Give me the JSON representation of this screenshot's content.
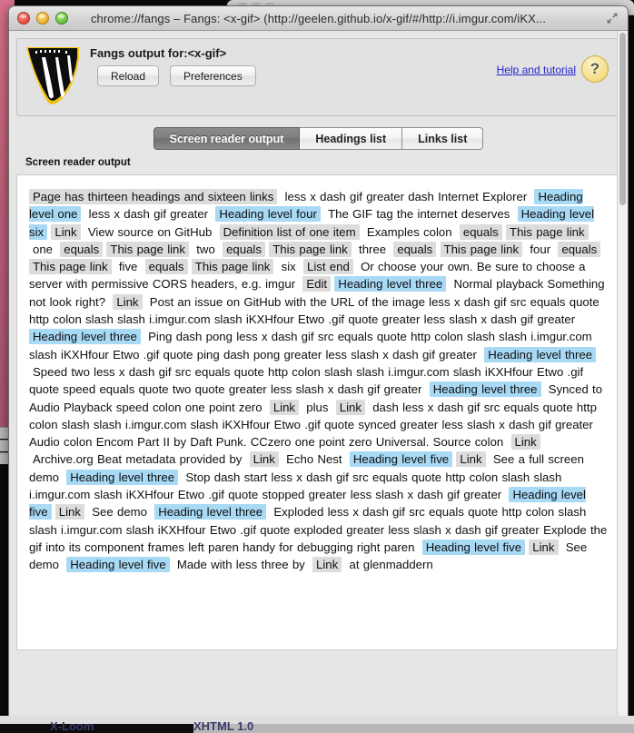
{
  "window": {
    "title": "chrome://fangs – Fangs: <x-gif> (http://geelen.github.io/x-gif/#/http://i.imgur.com/iKX...",
    "traffic_lights": [
      "close-button",
      "minimize-button",
      "zoom-button"
    ],
    "fullscreen_icon": "expand-arrows-icon"
  },
  "header": {
    "logo_icon": "fangs-logo-icon",
    "title": "Fangs output for:<x-gif>",
    "reload_label": "Reload",
    "preferences_label": "Preferences",
    "help_link_label": "Help and tutorial",
    "help_badge_glyph": "?"
  },
  "tabs": [
    {
      "label": "Screen reader output",
      "active": true
    },
    {
      "label": "Headings list",
      "active": false
    },
    {
      "label": "Links list",
      "active": false
    }
  ],
  "main": {
    "section_label": "Screen reader output",
    "segments": [
      {
        "kind": "struct",
        "text": "Page has thirteen headings and sixteen links"
      },
      {
        "kind": "plain",
        "text": "less x dash gif greater dash Internet Explorer"
      },
      {
        "kind": "head",
        "text": "Heading level one"
      },
      {
        "kind": "plain",
        "text": "less x dash gif greater"
      },
      {
        "kind": "head",
        "text": "Heading level four"
      },
      {
        "kind": "plain",
        "text": "The GIF tag the internet deserves"
      },
      {
        "kind": "head",
        "text": "Heading level six"
      },
      {
        "kind": "struct",
        "text": "Link"
      },
      {
        "kind": "plain",
        "text": "View source on GitHub"
      },
      {
        "kind": "struct",
        "text": "Definition list of one item"
      },
      {
        "kind": "plain",
        "text": "Examples colon"
      },
      {
        "kind": "struct",
        "text": "equals"
      },
      {
        "kind": "struct",
        "text": "This page link"
      },
      {
        "kind": "plain",
        "text": "one"
      },
      {
        "kind": "struct",
        "text": "equals"
      },
      {
        "kind": "struct",
        "text": "This page link"
      },
      {
        "kind": "plain",
        "text": "two"
      },
      {
        "kind": "struct",
        "text": "equals"
      },
      {
        "kind": "struct",
        "text": "This page link"
      },
      {
        "kind": "plain",
        "text": "three"
      },
      {
        "kind": "struct",
        "text": "equals"
      },
      {
        "kind": "struct",
        "text": "This page link"
      },
      {
        "kind": "plain",
        "text": "four"
      },
      {
        "kind": "struct",
        "text": "equals"
      },
      {
        "kind": "struct",
        "text": "This page link"
      },
      {
        "kind": "plain",
        "text": "five"
      },
      {
        "kind": "struct",
        "text": "equals"
      },
      {
        "kind": "struct",
        "text": "This page link"
      },
      {
        "kind": "plain",
        "text": "six"
      },
      {
        "kind": "struct",
        "text": "List end"
      },
      {
        "kind": "plain",
        "text": "Or choose your own. Be sure to choose a server with permissive CORS headers, e.g. imgur"
      },
      {
        "kind": "struct",
        "text": "Edit"
      },
      {
        "kind": "head",
        "text": "Heading level three"
      },
      {
        "kind": "plain",
        "text": "Normal playback Something not look right?"
      },
      {
        "kind": "struct",
        "text": "Link"
      },
      {
        "kind": "plain",
        "text": "Post an issue on GitHub with the URL of the image less x dash gif src equals quote http colon slash slash i.imgur.com slash iKXHfour Etwo .gif quote greater less slash x dash gif greater"
      },
      {
        "kind": "head",
        "text": "Heading level three"
      },
      {
        "kind": "plain",
        "text": "Ping dash pong less x dash gif src equals quote http colon slash slash i.imgur.com slash iKXHfour Etwo .gif quote ping dash pong greater less slash x dash gif greater"
      },
      {
        "kind": "head",
        "text": "Heading level three"
      },
      {
        "kind": "plain",
        "text": "Speed two less x dash gif src equals quote http colon slash slash i.imgur.com slash iKXHfour Etwo .gif quote speed equals quote two quote greater less slash x dash gif greater"
      },
      {
        "kind": "head",
        "text": "Heading level three"
      },
      {
        "kind": "plain",
        "text": "Synced to Audio Playback speed colon one point zero"
      },
      {
        "kind": "struct",
        "text": "Link"
      },
      {
        "kind": "plain",
        "text": "plus"
      },
      {
        "kind": "struct",
        "text": "Link"
      },
      {
        "kind": "plain",
        "text": "dash less x dash gif src equals quote http colon slash slash i.imgur.com slash iKXHfour Etwo .gif quote synced greater less slash x dash gif greater Audio colon Encom Part II by Daft Punk. CCzero one point zero Universal. Source colon"
      },
      {
        "kind": "struct",
        "text": "Link"
      },
      {
        "kind": "plain",
        "text": "Archive.org Beat metadata provided by"
      },
      {
        "kind": "struct",
        "text": "Link"
      },
      {
        "kind": "plain",
        "text": "Echo Nest"
      },
      {
        "kind": "head",
        "text": "Heading level five"
      },
      {
        "kind": "struct",
        "text": "Link"
      },
      {
        "kind": "plain",
        "text": "See a full screen demo"
      },
      {
        "kind": "head",
        "text": "Heading level three"
      },
      {
        "kind": "plain",
        "text": "Stop dash start less x dash gif src equals quote http colon slash slash i.imgur.com slash iKXHfour Etwo .gif quote stopped greater less slash x dash gif greater"
      },
      {
        "kind": "head",
        "text": "Heading level five"
      },
      {
        "kind": "struct",
        "text": "Link"
      },
      {
        "kind": "plain",
        "text": "See demo"
      },
      {
        "kind": "head",
        "text": "Heading level three"
      },
      {
        "kind": "plain",
        "text": "Exploded less x dash gif src equals quote http colon slash slash i.imgur.com slash iKXHfour Etwo .gif quote exploded greater less slash x dash gif greater Explode the gif into its component frames left paren handy for debugging right paren"
      },
      {
        "kind": "head",
        "text": "Heading level five"
      },
      {
        "kind": "struct",
        "text": "Link"
      },
      {
        "kind": "plain",
        "text": "See demo"
      },
      {
        "kind": "head",
        "text": "Heading level five"
      },
      {
        "kind": "plain",
        "text": "Made with less three by"
      },
      {
        "kind": "struct",
        "text": "Link"
      },
      {
        "kind": "plain",
        "text": "at glenmaddern"
      }
    ]
  },
  "background": {
    "bottom_text_left": "X-Loom",
    "bottom_text_right": "XHTML 1.0"
  }
}
